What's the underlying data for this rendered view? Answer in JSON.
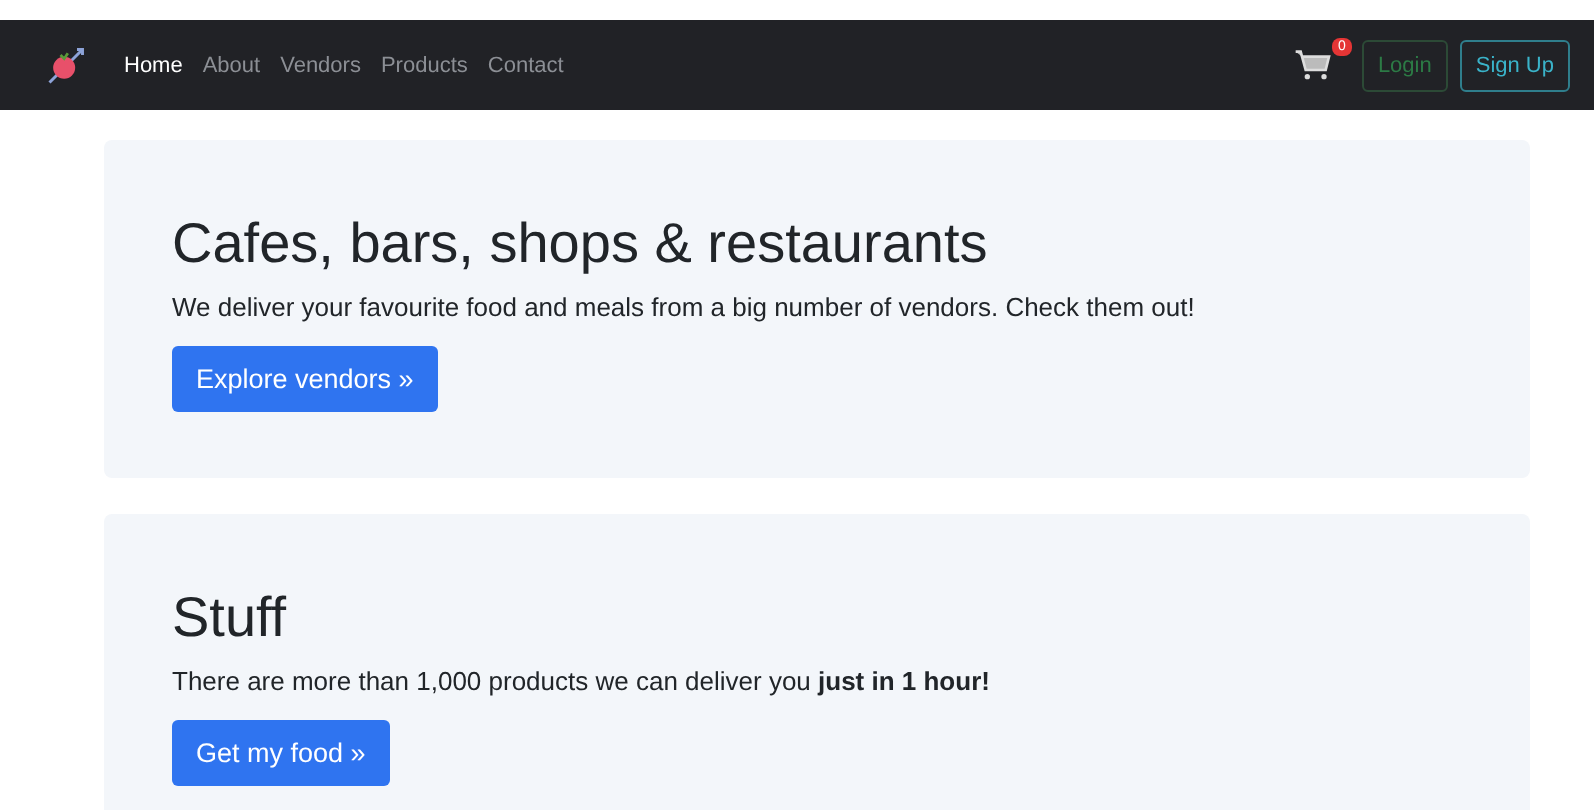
{
  "navbar": {
    "links": [
      {
        "label": "Home",
        "selected": true
      },
      {
        "label": "About",
        "selected": false
      },
      {
        "label": "Vendors",
        "selected": false
      },
      {
        "label": "Products",
        "selected": false
      },
      {
        "label": "Contact",
        "selected": false
      }
    ],
    "cart_count": "0",
    "login": "Login",
    "signup": "Sign Up"
  },
  "sections": [
    {
      "title": "Cafes, bars, shops & restaurants",
      "text": "We deliver your favourite food and meals from a big number of vendors. Check them out!",
      "button": "Explore vendors »"
    },
    {
      "title": "Stuff",
      "text": "There are more than 1,000 products we can deliver you **just in 1 hour!**",
      "button": "Get my food »"
    }
  ]
}
